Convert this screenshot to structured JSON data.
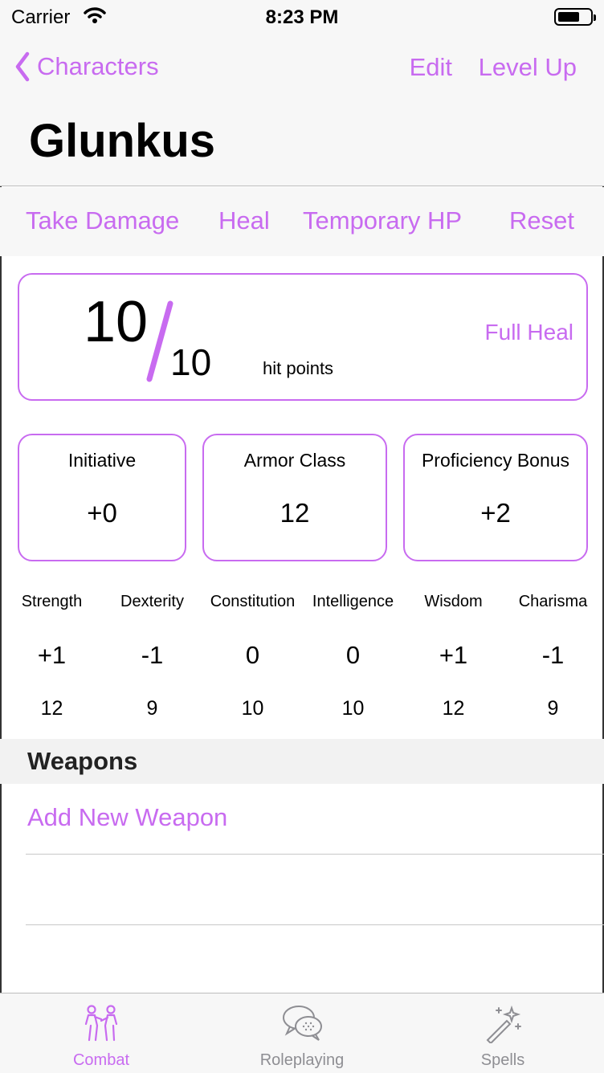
{
  "status_bar": {
    "carrier": "Carrier",
    "time": "8:23 PM"
  },
  "nav": {
    "back_label": "Characters",
    "edit_label": "Edit",
    "level_up_label": "Level Up",
    "title": "Glunkus"
  },
  "actions": {
    "take_damage": "Take Damage",
    "heal": "Heal",
    "temporary_hp": "Temporary HP",
    "reset": "Reset"
  },
  "hp": {
    "current": "10",
    "slash": "/",
    "max": "10",
    "label": "hit points",
    "full_heal": "Full Heal"
  },
  "stats": [
    {
      "label": "Initiative",
      "value": "+0"
    },
    {
      "label": "Armor Class",
      "value": "12"
    },
    {
      "label": "Proficiency Bonus",
      "value": "+2"
    }
  ],
  "abilities": [
    {
      "name": "Strength",
      "modifier": "+1",
      "score": "12"
    },
    {
      "name": "Dexterity",
      "modifier": "-1",
      "score": "9"
    },
    {
      "name": "Constitution",
      "modifier": "0",
      "score": "10"
    },
    {
      "name": "Intelligence",
      "modifier": "0",
      "score": "10"
    },
    {
      "name": "Wisdom",
      "modifier": "+1",
      "score": "12"
    },
    {
      "name": "Charisma",
      "modifier": "-1",
      "score": "9"
    }
  ],
  "weapons": {
    "header": "Weapons",
    "add_label": "Add New Weapon"
  },
  "tabs": [
    {
      "label": "Combat",
      "icon": "combat-icon",
      "active": true
    },
    {
      "label": "Roleplaying",
      "icon": "speech-bubbles-icon",
      "active": false
    },
    {
      "label": "Spells",
      "icon": "magic-wand-icon",
      "active": false
    }
  ],
  "colors": {
    "accent": "#c86bf0",
    "inactive": "#8e8e93"
  }
}
